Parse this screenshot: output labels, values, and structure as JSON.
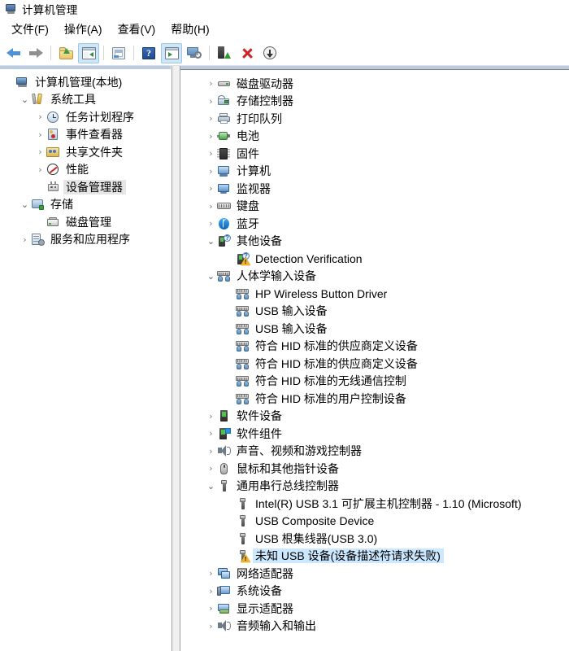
{
  "window": {
    "title": "计算机管理",
    "icon": "computer-management-icon"
  },
  "menubar": {
    "items": [
      {
        "label": "文件(F)",
        "name": "menu-file"
      },
      {
        "label": "操作(A)",
        "name": "menu-action"
      },
      {
        "label": "查看(V)",
        "name": "menu-view"
      },
      {
        "label": "帮助(H)",
        "name": "menu-help"
      }
    ]
  },
  "toolbar": {
    "buttons": [
      {
        "name": "back-button",
        "icon": "arrow-back-icon",
        "active": false
      },
      {
        "name": "forward-button",
        "icon": "arrow-forward-icon",
        "active": false
      },
      {
        "name": "up-one-level-button",
        "icon": "folder-up-icon",
        "active": false
      },
      {
        "name": "show-hide-console-tree-button",
        "icon": "console-tree-icon",
        "active": true
      },
      {
        "name": "properties-button",
        "icon": "properties-icon",
        "active": false
      },
      {
        "name": "help-button",
        "icon": "help-icon",
        "active": false
      },
      {
        "name": "show-hide-action-pane-button",
        "icon": "action-pane-icon",
        "active": true
      },
      {
        "name": "scan-hardware-changes-button",
        "icon": "scan-monitor-icon",
        "active": false
      },
      {
        "name": "update-driver-button",
        "icon": "update-driver-icon",
        "active": false
      },
      {
        "name": "uninstall-device-button",
        "icon": "red-x-icon",
        "active": false
      },
      {
        "name": "disable-device-button",
        "icon": "down-arrow-circle-icon",
        "active": false
      }
    ]
  },
  "left_tree": {
    "items": [
      {
        "label": "计算机管理(本地)",
        "indent": 0,
        "twisty": "none",
        "icon": "i-mmc",
        "icon_name": "computer-management-icon",
        "selected": false
      },
      {
        "label": "系统工具",
        "indent": 1,
        "twisty": "open",
        "icon": "i-tools",
        "icon_name": "system-tools-icon",
        "selected": false
      },
      {
        "label": "任务计划程序",
        "indent": 2,
        "twisty": "closed",
        "icon": "i-clock",
        "icon_name": "task-scheduler-icon",
        "selected": false
      },
      {
        "label": "事件查看器",
        "indent": 2,
        "twisty": "closed",
        "icon": "i-event",
        "icon_name": "event-viewer-icon",
        "selected": false
      },
      {
        "label": "共享文件夹",
        "indent": 2,
        "twisty": "closed",
        "icon": "i-share",
        "icon_name": "shared-folders-icon",
        "selected": false
      },
      {
        "label": "性能",
        "indent": 2,
        "twisty": "closed",
        "icon": "i-perf",
        "icon_name": "performance-icon",
        "selected": false
      },
      {
        "label": "设备管理器",
        "indent": 2,
        "twisty": "none",
        "icon": "i-devmgr",
        "icon_name": "device-manager-icon",
        "selected": true
      },
      {
        "label": "存储",
        "indent": 1,
        "twisty": "open",
        "icon": "i-storage",
        "icon_name": "storage-icon",
        "selected": false
      },
      {
        "label": "磁盘管理",
        "indent": 2,
        "twisty": "none",
        "icon": "i-disk",
        "icon_name": "disk-management-icon",
        "selected": false
      },
      {
        "label": "服务和应用程序",
        "indent": 1,
        "twisty": "closed",
        "icon": "i-services",
        "icon_name": "services-and-applications-icon",
        "selected": false
      }
    ]
  },
  "device_tree": {
    "items": [
      {
        "label": "磁盘驱动器",
        "indent": 0,
        "twisty": "closed",
        "icon": "i-hdd",
        "icon_name": "disk-drives-icon",
        "warning": false,
        "selected": false
      },
      {
        "label": "存储控制器",
        "indent": 0,
        "twisty": "closed",
        "icon": "i-storctrl",
        "icon_name": "storage-controllers-icon",
        "warning": false,
        "selected": false
      },
      {
        "label": "打印队列",
        "indent": 0,
        "twisty": "closed",
        "icon": "i-printer",
        "icon_name": "print-queues-icon",
        "warning": false,
        "selected": false
      },
      {
        "label": "电池",
        "indent": 0,
        "twisty": "closed",
        "icon": "i-battery",
        "icon_name": "batteries-icon",
        "warning": false,
        "selected": false
      },
      {
        "label": "固件",
        "indent": 0,
        "twisty": "closed",
        "icon": "i-firmware",
        "icon_name": "firmware-icon",
        "warning": false,
        "selected": false
      },
      {
        "label": "计算机",
        "indent": 0,
        "twisty": "closed",
        "icon": "i-computer",
        "icon_name": "computer-icon",
        "warning": false,
        "selected": false
      },
      {
        "label": "监视器",
        "indent": 0,
        "twisty": "closed",
        "icon": "i-monitor",
        "icon_name": "monitors-icon",
        "warning": false,
        "selected": false
      },
      {
        "label": "键盘",
        "indent": 0,
        "twisty": "closed",
        "icon": "i-keyboard",
        "icon_name": "keyboards-icon",
        "warning": false,
        "selected": false
      },
      {
        "label": "蓝牙",
        "indent": 0,
        "twisty": "closed",
        "icon": "i-bt",
        "icon_name": "bluetooth-icon",
        "warning": false,
        "selected": false
      },
      {
        "label": "其他设备",
        "indent": 0,
        "twisty": "open",
        "icon": "i-other",
        "icon_name": "other-devices-icon",
        "warning": false,
        "selected": false
      },
      {
        "label": "Detection Verification",
        "indent": 1,
        "twisty": "none",
        "icon": "i-other",
        "icon_name": "unknown-device-icon",
        "warning": true,
        "selected": false
      },
      {
        "label": "人体学输入设备",
        "indent": 0,
        "twisty": "open",
        "icon": "i-hid",
        "icon_name": "human-interface-devices-icon",
        "warning": false,
        "selected": false
      },
      {
        "label": "HP Wireless Button Driver",
        "indent": 1,
        "twisty": "none",
        "icon": "i-hid",
        "icon_name": "hid-device-icon",
        "warning": false,
        "selected": false
      },
      {
        "label": "USB 输入设备",
        "indent": 1,
        "twisty": "none",
        "icon": "i-hid",
        "icon_name": "hid-device-icon",
        "warning": false,
        "selected": false
      },
      {
        "label": "USB 输入设备",
        "indent": 1,
        "twisty": "none",
        "icon": "i-hid",
        "icon_name": "hid-device-icon",
        "warning": false,
        "selected": false
      },
      {
        "label": "符合 HID 标准的供应商定义设备",
        "indent": 1,
        "twisty": "none",
        "icon": "i-hid",
        "icon_name": "hid-device-icon",
        "warning": false,
        "selected": false
      },
      {
        "label": "符合 HID 标准的供应商定义设备",
        "indent": 1,
        "twisty": "none",
        "icon": "i-hid",
        "icon_name": "hid-device-icon",
        "warning": false,
        "selected": false
      },
      {
        "label": "符合 HID 标准的无线通信控制",
        "indent": 1,
        "twisty": "none",
        "icon": "i-hid",
        "icon_name": "hid-device-icon",
        "warning": false,
        "selected": false
      },
      {
        "label": "符合 HID 标准的用户控制设备",
        "indent": 1,
        "twisty": "none",
        "icon": "i-hid",
        "icon_name": "hid-device-icon",
        "warning": false,
        "selected": false
      },
      {
        "label": "软件设备",
        "indent": 0,
        "twisty": "closed",
        "icon": "i-swdev",
        "icon_name": "software-devices-icon",
        "warning": false,
        "selected": false
      },
      {
        "label": "软件组件",
        "indent": 0,
        "twisty": "closed",
        "icon": "i-swcomp",
        "icon_name": "software-components-icon",
        "warning": false,
        "selected": false
      },
      {
        "label": "声音、视频和游戏控制器",
        "indent": 0,
        "twisty": "closed",
        "icon": "i-sound",
        "icon_name": "sound-video-game-controllers-icon",
        "warning": false,
        "selected": false
      },
      {
        "label": "鼠标和其他指针设备",
        "indent": 0,
        "twisty": "closed",
        "icon": "i-mouse",
        "icon_name": "mice-and-pointing-devices-icon",
        "warning": false,
        "selected": false
      },
      {
        "label": "通用串行总线控制器",
        "indent": 0,
        "twisty": "open",
        "icon": "i-usb",
        "icon_name": "usb-controllers-icon",
        "warning": false,
        "selected": false
      },
      {
        "label": "Intel(R) USB 3.1 可扩展主机控制器 - 1.10 (Microsoft)",
        "indent": 1,
        "twisty": "none",
        "icon": "i-usb",
        "icon_name": "usb-device-icon",
        "warning": false,
        "selected": false
      },
      {
        "label": "USB Composite Device",
        "indent": 1,
        "twisty": "none",
        "icon": "i-usb",
        "icon_name": "usb-device-icon",
        "warning": false,
        "selected": false
      },
      {
        "label": "USB 根集线器(USB 3.0)",
        "indent": 1,
        "twisty": "none",
        "icon": "i-usb",
        "icon_name": "usb-device-icon",
        "warning": false,
        "selected": false
      },
      {
        "label": "未知 USB 设备(设备描述符请求失败)",
        "indent": 1,
        "twisty": "none",
        "icon": "i-usb",
        "icon_name": "unknown-usb-device-icon",
        "warning": true,
        "selected": true
      },
      {
        "label": "网络适配器",
        "indent": 0,
        "twisty": "closed",
        "icon": "i-net",
        "icon_name": "network-adapters-icon",
        "warning": false,
        "selected": false
      },
      {
        "label": "系统设备",
        "indent": 0,
        "twisty": "closed",
        "icon": "i-sysdev",
        "icon_name": "system-devices-icon",
        "warning": false,
        "selected": false
      },
      {
        "label": "显示适配器",
        "indent": 0,
        "twisty": "closed",
        "icon": "i-display",
        "icon_name": "display-adapters-icon",
        "warning": false,
        "selected": false
      },
      {
        "label": "音频输入和输出",
        "indent": 0,
        "twisty": "closed",
        "icon": "i-sound",
        "icon_name": "audio-inputs-outputs-icon",
        "warning": false,
        "selected": false
      }
    ]
  },
  "glyphs": {
    "twisty_closed": "›",
    "twisty_open": "⌄",
    "help_char": "?",
    "bluetooth_char": "ᚴ",
    "question_char": "?"
  },
  "colors": {
    "selection_active": "#cce8ff",
    "selection_inactive": "#e6e6e6",
    "toolbar_active": "#cfe6f7",
    "pane_header": "#b8cce4",
    "warning": "#f0b323",
    "delete_red": "#d32020"
  }
}
